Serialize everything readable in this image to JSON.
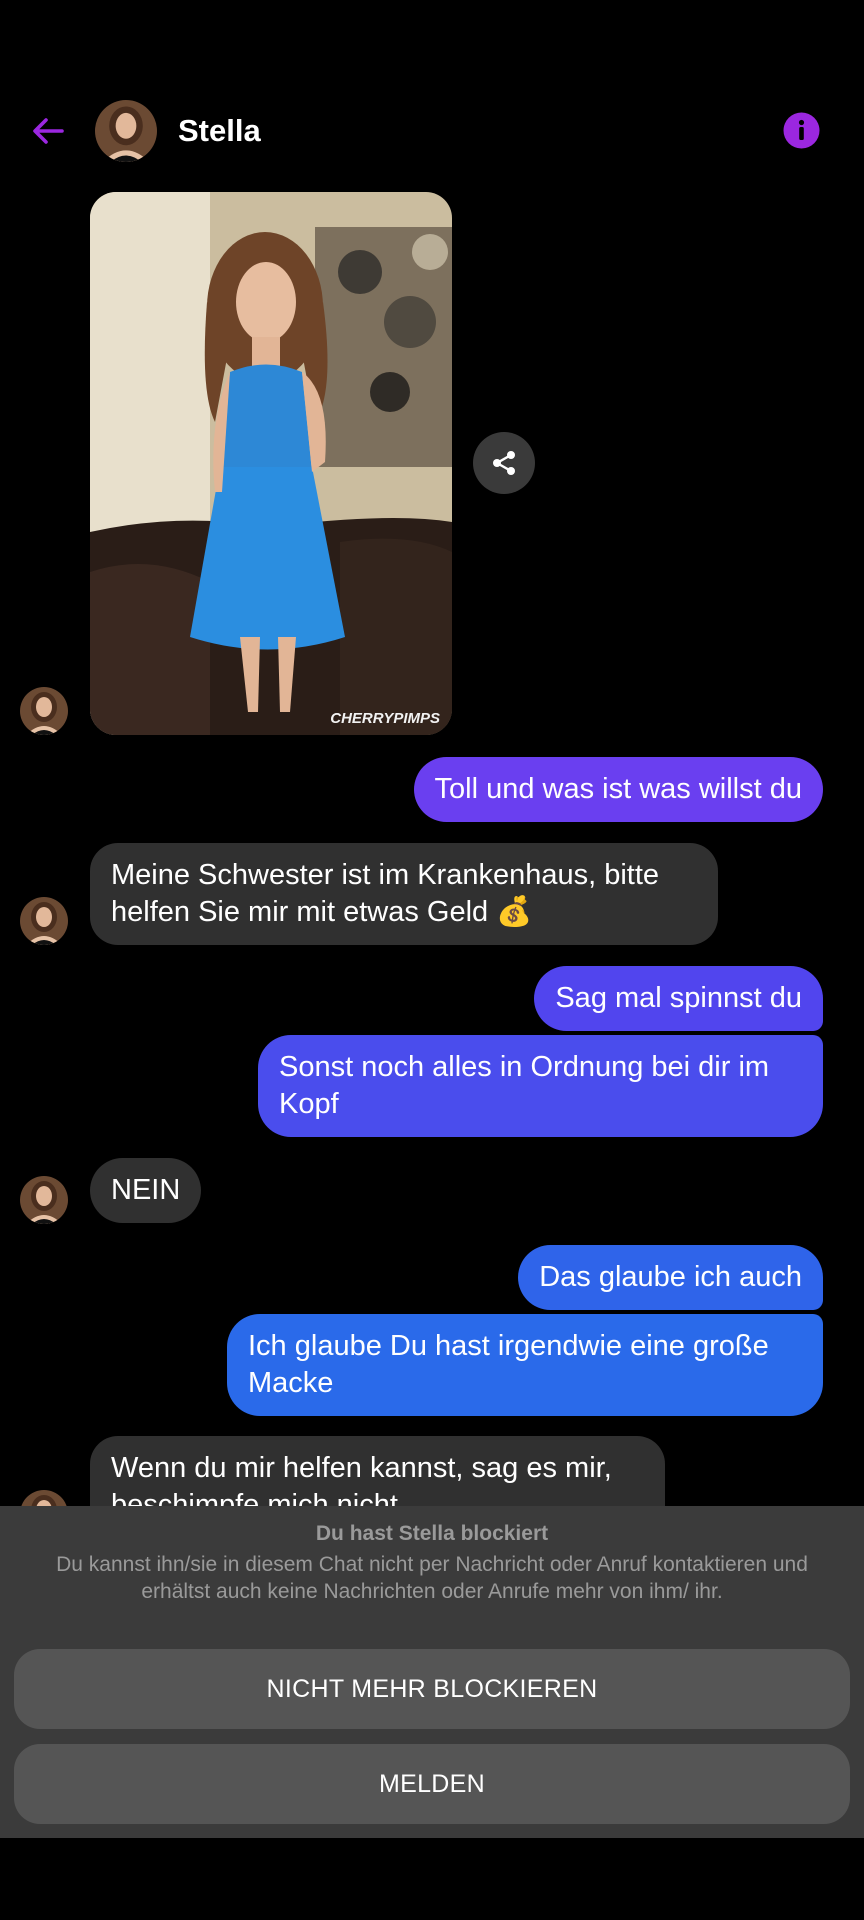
{
  "header": {
    "back_icon": "arrow-left-icon",
    "contact_name": "Stella",
    "info_icon": "info-icon",
    "accent": "#9b27e0"
  },
  "media": {
    "watermark": "CHERRYPIMPS",
    "share_icon": "share-icon"
  },
  "messages": [
    {
      "side": "out",
      "text": "Toll und was ist was willst du",
      "color": "#6a3ff0"
    },
    {
      "side": "in",
      "text": "Meine Schwester ist im Krankenhaus, bitte helfen Sie mir mit etwas Geld 💰"
    },
    {
      "side": "out",
      "text": "Sag mal spinnst du",
      "color": "#5145ee"
    },
    {
      "side": "out",
      "text": "Sonst noch alles in Ordnung bei dir im Kopf",
      "color": "#4a4ded"
    },
    {
      "side": "in",
      "text": "NEIN"
    },
    {
      "side": "out",
      "text": "Das glaube ich auch",
      "color": "#2f64ea"
    },
    {
      "side": "out",
      "text": "Ich glaube Du hast irgendwie eine große Macke",
      "color": "#2a6aea"
    },
    {
      "side": "in",
      "text": "Wenn du mir helfen kannst, sag es mir, beschimpfe mich nicht"
    }
  ],
  "block": {
    "title": "Du hast Stella blockiert",
    "description": "Du kannst ihn/sie in diesem Chat nicht per Nachricht oder Anruf kontaktieren und erhältst auch keine Nachrichten oder Anrufe mehr von ihm/ ihr.",
    "unblock_label": "NICHT MEHR BLOCKIEREN",
    "report_label": "MELDEN"
  }
}
